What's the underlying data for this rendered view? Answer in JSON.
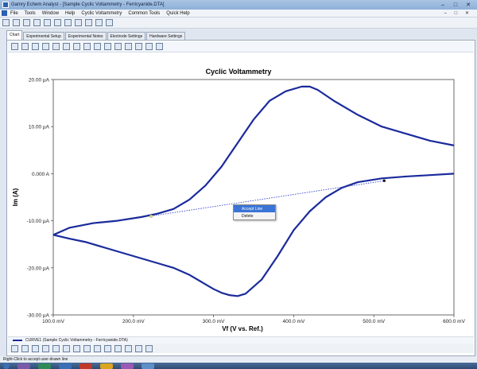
{
  "window": {
    "title": "Gamry Echem Analyst - [Sample Cyclic Voltammetry - Ferricyanide.DTA]",
    "controls": [
      "–",
      "□",
      "✕"
    ]
  },
  "menubar": {
    "items": [
      "File",
      "Tools",
      "Window",
      "Help",
      "Cyclic Voltammetry",
      "Common Tools",
      "Quick Help"
    ],
    "mdi_controls": "– □ ✕"
  },
  "tabs": [
    "Chart",
    "Experimental Setup",
    "Experimental Notes",
    "Electrode Settings",
    "Hardware Settings"
  ],
  "active_tab": "Chart",
  "context_menu": {
    "items": [
      "Accept Line",
      "Delete"
    ],
    "highlighted": "Accept Line"
  },
  "legend": {
    "label": "CURVE1 (Sample Cyclic Voltammetry - Ferricyanide.DTA)"
  },
  "status": {
    "text": "Right-Click to accept user-drawn line"
  },
  "chart_data": {
    "type": "line",
    "title": "Cyclic Voltammetry",
    "xlabel": "Vf (V vs. Ref.)",
    "ylabel": "Im (A)",
    "xlim": [
      100,
      600
    ],
    "ylim": [
      -30,
      20
    ],
    "x_ticks": [
      "100.0 mV",
      "200.0 mV",
      "300.0 mV",
      "400.0 mV",
      "500.0 mV",
      "600.0 mV"
    ],
    "y_ticks": [
      "20.00 µA",
      "10.00 µA",
      "0.000 A",
      "-10.00 µA",
      "-20.00 µA",
      "-30.00 µA"
    ],
    "line_color": "#1a2a9c",
    "grid": false,
    "series": [
      {
        "x": [
          100,
          120,
          150,
          180,
          210,
          230,
          250,
          270,
          290,
          310,
          330,
          350,
          370,
          390,
          410,
          420,
          430,
          450,
          480,
          510,
          540,
          570,
          600
        ],
        "y": [
          -13,
          -11.5,
          -10.5,
          -10,
          -9.2,
          -8.5,
          -7.5,
          -5.5,
          -2.5,
          1.5,
          6.5,
          11.5,
          15.5,
          17.5,
          18.5,
          18.5,
          17.8,
          15.5,
          12.5,
          10,
          8.5,
          7,
          6
        ]
      },
      {
        "x": [
          600,
          570,
          540,
          510,
          480,
          460,
          440,
          420,
          400,
          380,
          360,
          340,
          330,
          320,
          310,
          300,
          290,
          270,
          250,
          230,
          200,
          170,
          140,
          120,
          100
        ],
        "y": [
          0,
          -0.3,
          -0.6,
          -1,
          -1.8,
          -3,
          -5,
          -8,
          -12,
          -17.5,
          -22.5,
          -25.5,
          -26,
          -25.8,
          -25.3,
          -24.5,
          -23.5,
          -21.5,
          -20,
          -19,
          -17.5,
          -16,
          -14.5,
          -13.8,
          -13
        ]
      }
    ],
    "user_line": {
      "x": [
        222,
        513
      ],
      "y": [
        -9,
        -1.5
      ]
    }
  }
}
